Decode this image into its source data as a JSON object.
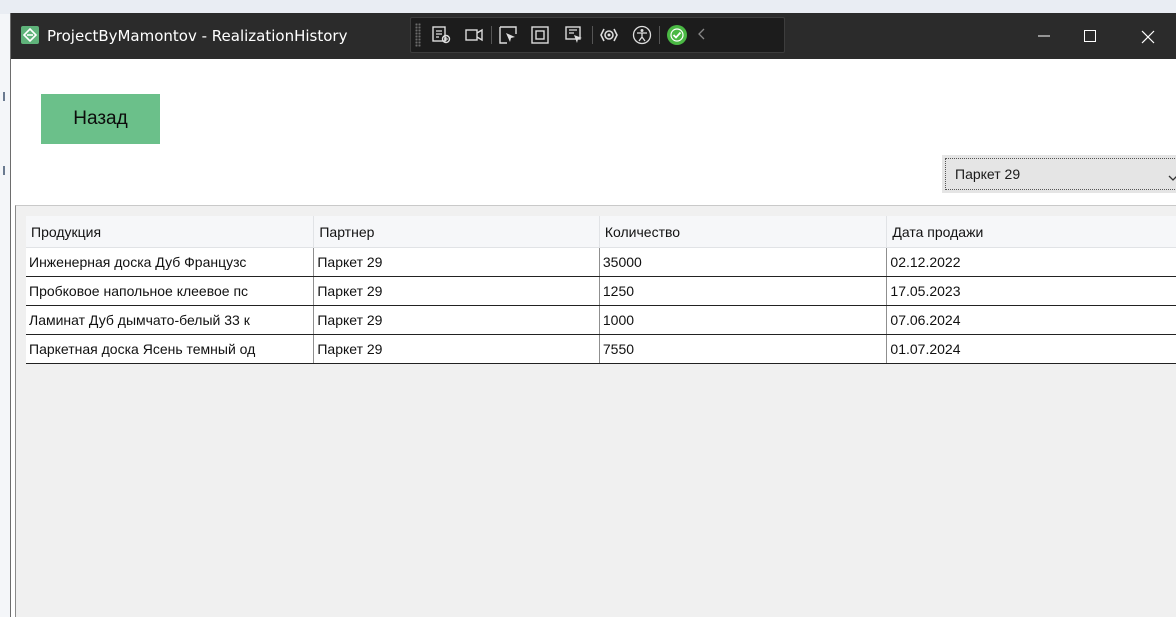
{
  "window": {
    "title": "ProjectByMamontov - RealizationHistory",
    "controls": [
      "minimize-icon",
      "maximize-icon",
      "close-icon"
    ]
  },
  "debug_toolbar": {
    "icons": [
      "live-visual-tree-icon",
      "camera-icon",
      "select-element-icon",
      "display-layout-adorners-icon",
      "track-focus-icon",
      "hot-reload-icon",
      "accessibility-icon",
      "binding-check-icon",
      "collapse-chevron-icon"
    ],
    "colors": {
      "background": "#1c1c1c",
      "check": "#4ab844"
    }
  },
  "back_button": {
    "label": "Назад",
    "color": "#6bc08a"
  },
  "partner_select": {
    "value": "Паркет 29",
    "icon": "chevron-down-icon"
  },
  "table": {
    "columns": [
      "Продукция",
      "Партнер",
      "Количество",
      "Дата продажи"
    ],
    "rows": [
      {
        "product": "Инженерная доска Дуб Французс",
        "partner": "Паркет 29",
        "quantity": "35000",
        "date": "02.12.2022"
      },
      {
        "product": "Пробковое напольное клеевое пс",
        "partner": "Паркет 29",
        "quantity": "1250",
        "date": "17.05.2023"
      },
      {
        "product": "Ламинат Дуб дымчато-белый 33 к",
        "partner": "Паркет 29",
        "quantity": "1000",
        "date": "07.06.2024"
      },
      {
        "product": "Паркетная доска Ясень темный од",
        "partner": "Паркет 29",
        "quantity": "7550",
        "date": "01.07.2024"
      }
    ]
  }
}
